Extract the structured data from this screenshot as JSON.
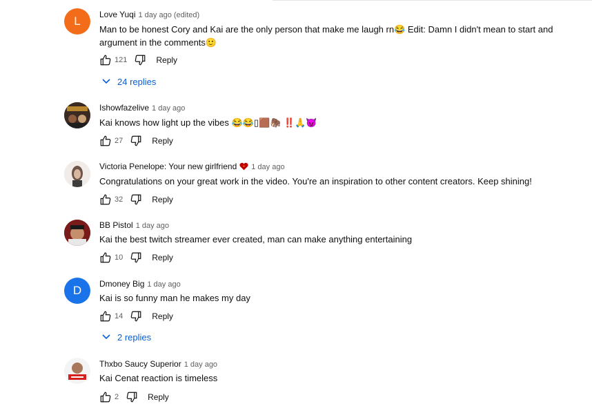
{
  "comments": [
    {
      "author": "Love Yuqi",
      "time": "1 day ago (edited)",
      "avatar_letter": "L",
      "avatar_color": "#f26c1a",
      "text_line1": "Man to be honest Cory and Kai are the only person that make me laugh rn😂   Edit: Damn I didn't mean to start and",
      "text_line2": "argument in the comments🙂",
      "likes": "121",
      "reply_label": "Reply",
      "replies_label": "24 replies"
    },
    {
      "author": "Ishowfazelive",
      "time": "1 day ago",
      "text_line1": "Kai knows how light up the vibes 😂😂▯🟫🦣 ‼️🙏😈",
      "likes": "27",
      "reply_label": "Reply"
    },
    {
      "author": "Victoria Penelope: Your new girlfriend",
      "time": "1 day ago",
      "text_line1": "Congratulations on your great work in the video. You're an inspiration to other content creators. Keep shining!",
      "likes": "32",
      "reply_label": "Reply"
    },
    {
      "author": "BB Pistol",
      "time": "1 day ago",
      "text_line1": "Kai the best twitch streamer ever created, man can make anything entertaining",
      "likes": "10",
      "reply_label": "Reply"
    },
    {
      "author": "Dmoney Big",
      "time": "1 day ago",
      "avatar_letter": "D",
      "avatar_color": "#1a73e8",
      "text_line1": "Kai is so funny man he makes my day",
      "likes": "14",
      "reply_label": "Reply",
      "replies_label": "2 replies"
    },
    {
      "author": "Thxbo Saucy Superior",
      "time": "1 day ago",
      "text_line1": "Kai Cenat reaction is timeless",
      "likes": "2",
      "reply_label": "Reply"
    }
  ],
  "colors": {
    "link": "#065fd4",
    "secondary_text": "#606060",
    "heart": "#c00000"
  },
  "icons": [
    "thumbs-up-icon",
    "thumbs-down-icon",
    "chevron-down-icon",
    "heart-icon"
  ]
}
